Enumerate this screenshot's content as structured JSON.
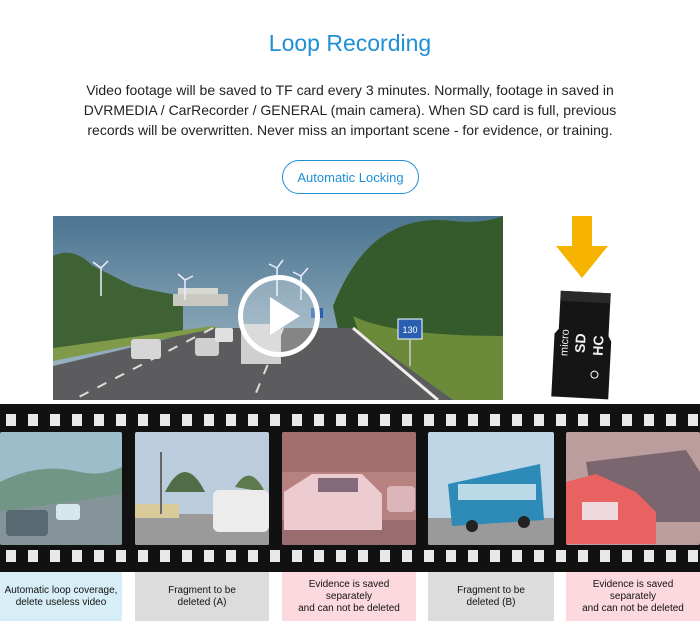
{
  "header": {
    "title": "Loop Recording",
    "description_lines": [
      "Video footage will be saved to TF card every 3 minutes.  Normally, footage in saved in",
      "DVRMEDIA / CarRecorder / GENERAL (main camera).  When SD card is full, previous",
      "records will be overwritten.  Never miss an important scene - for evidence, or training."
    ],
    "pill_label": "Automatic Locking"
  },
  "video": {
    "sign_number": "130"
  },
  "sdcard": {
    "brand_line1": "micro",
    "brand_line2": "SD",
    "brand_line3": "HC"
  },
  "film_labels": [
    {
      "lines": [
        "Automatic loop coverage,",
        "delete useless video"
      ],
      "tone": "blue"
    },
    {
      "lines": [
        "Fragment to be",
        "deleted (A)"
      ],
      "tone": "grey"
    },
    {
      "lines": [
        "Evidence is saved separately",
        "and can not be deleted"
      ],
      "tone": "pink"
    },
    {
      "lines": [
        "Fragment to be",
        "deleted (B)"
      ],
      "tone": "grey"
    },
    {
      "lines": [
        "Evidence is saved separately",
        "and can not be deleted"
      ],
      "tone": "pink"
    }
  ],
  "colors": {
    "accent": "#1f8fd6",
    "arrow": "#f6b400",
    "label_blue": "#d7eef7",
    "label_grey": "#dcdcdc",
    "label_pink": "#fbd9de"
  }
}
